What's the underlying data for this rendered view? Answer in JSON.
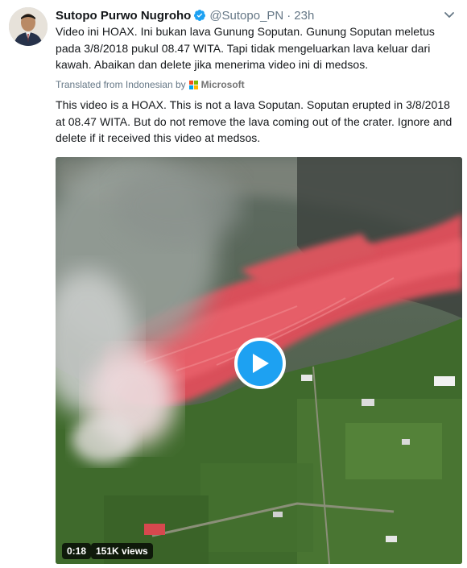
{
  "tweet": {
    "author_name": "Sutopo Purwo Nugroho",
    "handle": "@Sutopo_PN",
    "separator": "·",
    "time": "23h",
    "original_text": "Video ini HOAX. Ini bukan lava Gunung Soputan. Gunung Soputan meletus pada 3/8/2018 pukul 08.47 WITA. Tapi tidak mengeluarkan lava keluar dari kawah. Abaikan dan delete jika menerima video ini di medsos.",
    "translated_label": "Translated from Indonesian by",
    "translator_name": "Microsoft",
    "translation_text": "This video is a HOAX. This is not a lava Soputan. Soputan erupted in 3/8/2018 at 08.47 WITA. But do not remove the lava coming out of the crater. Ignore and delete if it received this video at medsos.",
    "video": {
      "duration": "0:18",
      "views": "151K views"
    }
  },
  "icons": {
    "verified": "verified-badge-icon",
    "menu": "chevron-down-icon",
    "play": "play-icon",
    "translator_logo": "microsoft-logo-icon"
  },
  "colors": {
    "accent": "#1da1f2",
    "secondary_text": "#657786",
    "ms_red": "#f25022",
    "ms_green": "#7fba00",
    "ms_blue": "#00a4ef",
    "ms_yellow": "#ffb900"
  }
}
